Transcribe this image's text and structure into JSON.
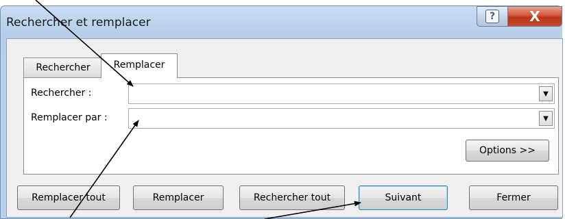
{
  "window": {
    "title": "Rechercher et remplacer",
    "help_glyph": "?",
    "close_glyph": "X"
  },
  "tabs": [
    {
      "label": "Rechercher",
      "active": false
    },
    {
      "label": "Remplacer",
      "active": true
    }
  ],
  "fields": {
    "find": {
      "label": "Rechercher :",
      "value": ""
    },
    "replace": {
      "label": "Remplacer par :",
      "value": ""
    }
  },
  "buttons": {
    "options": "Options >>",
    "replace_all": "Remplacer tout",
    "replace": "Remplacer",
    "find_all": "Rechercher tout",
    "next": "Suivant",
    "close": "Fermer"
  },
  "icons": {
    "dropdown_arrow": "chevron-down-icon",
    "help": "help-icon",
    "close": "close-icon"
  },
  "colors": {
    "title_bar": "#c9ddf3",
    "close_button": "#c84a2c",
    "default_button_border": "#3c7fb1"
  }
}
